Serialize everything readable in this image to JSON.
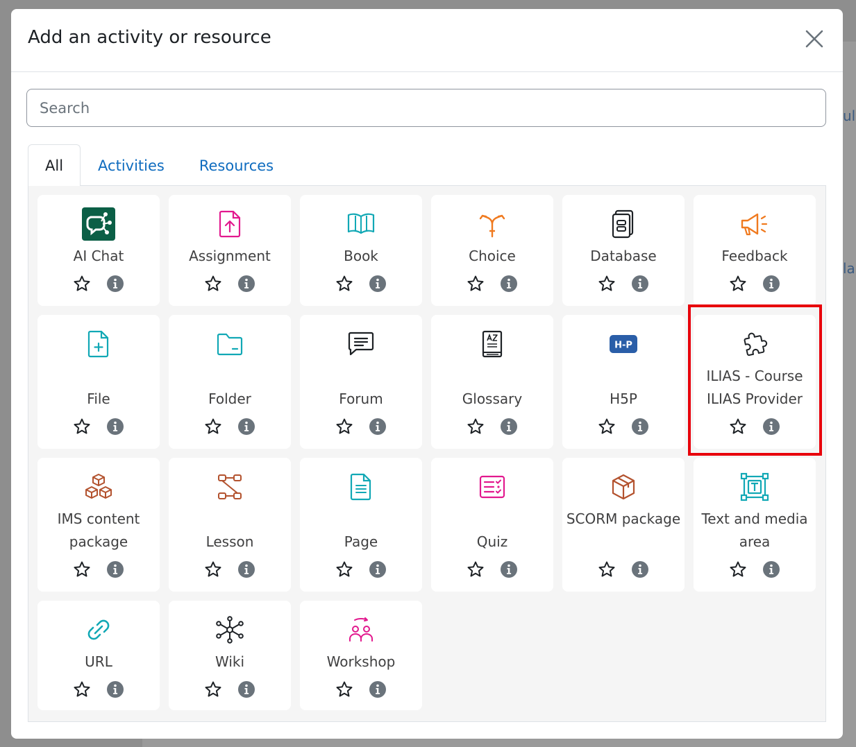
{
  "dialog": {
    "title": "Add an activity or resource",
    "close_label": "×"
  },
  "search": {
    "placeholder": "Search",
    "value": ""
  },
  "tabs": [
    {
      "label": "All",
      "active": true
    },
    {
      "label": "Activities",
      "active": false
    },
    {
      "label": "Resources",
      "active": false
    }
  ],
  "colors": {
    "link_blue": "#0f6cbf",
    "highlight_red": "#e8000b"
  },
  "modules": [
    {
      "name": "AI Chat",
      "icon": "ai-chat-icon"
    },
    {
      "name": "Assignment",
      "icon": "assignment-icon"
    },
    {
      "name": "Book",
      "icon": "book-icon"
    },
    {
      "name": "Choice",
      "icon": "choice-icon"
    },
    {
      "name": "Database",
      "icon": "database-icon"
    },
    {
      "name": "Feedback",
      "icon": "feedback-icon"
    },
    {
      "name": "File",
      "icon": "file-icon"
    },
    {
      "name": "Folder",
      "icon": "folder-icon"
    },
    {
      "name": "Forum",
      "icon": "forum-icon"
    },
    {
      "name": "Glossary",
      "icon": "glossary-icon"
    },
    {
      "name": "H5P",
      "icon": "h5p-icon"
    },
    {
      "name": "ILIAS - Course ILIAS Provider",
      "icon": "puzzle-icon"
    },
    {
      "name": "IMS content package",
      "icon": "ims-package-icon"
    },
    {
      "name": "Lesson",
      "icon": "lesson-icon"
    },
    {
      "name": "Page",
      "icon": "page-icon"
    },
    {
      "name": "Quiz",
      "icon": "quiz-icon"
    },
    {
      "name": "SCORM package",
      "icon": "scorm-icon"
    },
    {
      "name": "Text and media area",
      "icon": "text-media-icon"
    },
    {
      "name": "URL",
      "icon": "url-icon"
    },
    {
      "name": "Wiki",
      "icon": "wiki-icon"
    },
    {
      "name": "Workshop",
      "icon": "workshop-icon"
    }
  ],
  "background": {
    "edge_text_1": "ulk",
    "edge_text_2": "la"
  }
}
